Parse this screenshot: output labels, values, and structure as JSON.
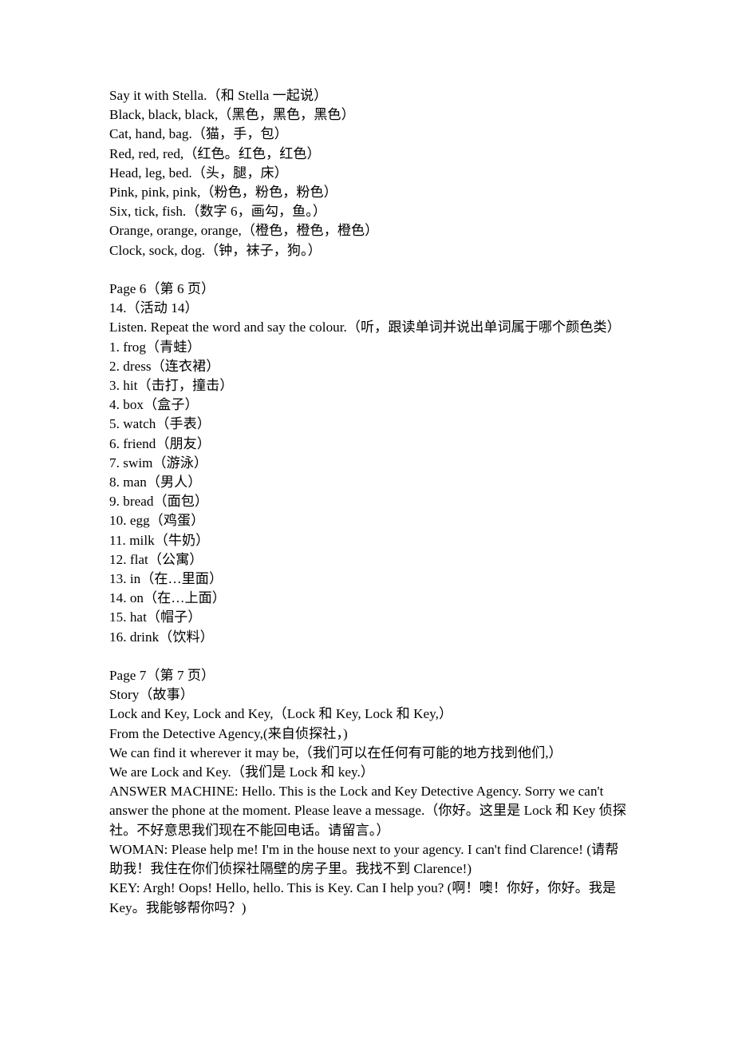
{
  "document": {
    "type": "teaching-script",
    "text_color": "#000000",
    "background_color": "#ffffff",
    "blocks": [
      {
        "id": "chant-section",
        "name": "say-it-with-stella-chant",
        "lines": [
          "Say it with Stella.（和 Stella 一起说）",
          "Black, black, black,（黑色，黑色，黑色）",
          "Cat, hand, bag.（猫，手，包）",
          "Red, red, red,（红色。红色，红色）",
          "Head, leg, bed.（头，腿，床）",
          "Pink, pink, pink,（粉色，粉色，粉色）",
          "Six, tick, fish.（数字 6，画勾，鱼。）",
          "Orange, orange, orange,（橙色，橙色，橙色）",
          "Clock, sock, dog.（钟，袜子，狗。）"
        ]
      },
      {
        "id": "page-6-section",
        "name": "page-6-activity-14",
        "lines": [
          "Page 6（第 6 页）",
          "14.（活动 14）",
          "Listen. Repeat the word and say the colour.（听，跟读单词并说出单词属于哪个颜色类）",
          "1. frog（青蛙）",
          "2. dress（连衣裙）",
          "3. hit（击打，撞击）",
          "4. box（盒子）",
          "5. watch（手表）",
          "6. friend（朋友）",
          "7. swim（游泳）",
          "8. man（男人）",
          "9. bread（面包）",
          "10. egg（鸡蛋）",
          "11. milk（牛奶）",
          "12. flat（公寓）",
          "13. in（在…里面）",
          "14. on（在…上面）",
          "15. hat（帽子）",
          "16. drink（饮料）"
        ]
      },
      {
        "id": "page-7-section",
        "name": "page-7-story",
        "lines": [
          "Page 7（第 7 页）",
          "Story（故事）",
          "Lock and Key, Lock and Key,（Lock 和 Key, Lock 和 Key,）",
          "From the Detective Agency,(来自侦探社，)",
          "We can find it wherever it may be,（我们可以在任何有可能的地方找到他们,）",
          "We are Lock and Key.（我们是 Lock 和 key.）",
          "ANSWER MACHINE: Hello. This is the Lock and Key Detective Agency. Sorry we can't answer the phone at the moment. Please leave a message.（你好。这里是 Lock 和 Key 侦探社。不好意思我们现在不能回电话。请留言。）",
          "WOMAN: Please help me! I'm in the house next to your agency. I can't find Clarence! (请帮助我！我住在你们侦探社隔壁的房子里。我找不到 Clarence!)",
          "KEY: Argh! Oops! Hello, hello. This is Key. Can I help you? (啊！噢！你好，你好。我是 Key。我能够帮你吗？)"
        ]
      }
    ]
  }
}
